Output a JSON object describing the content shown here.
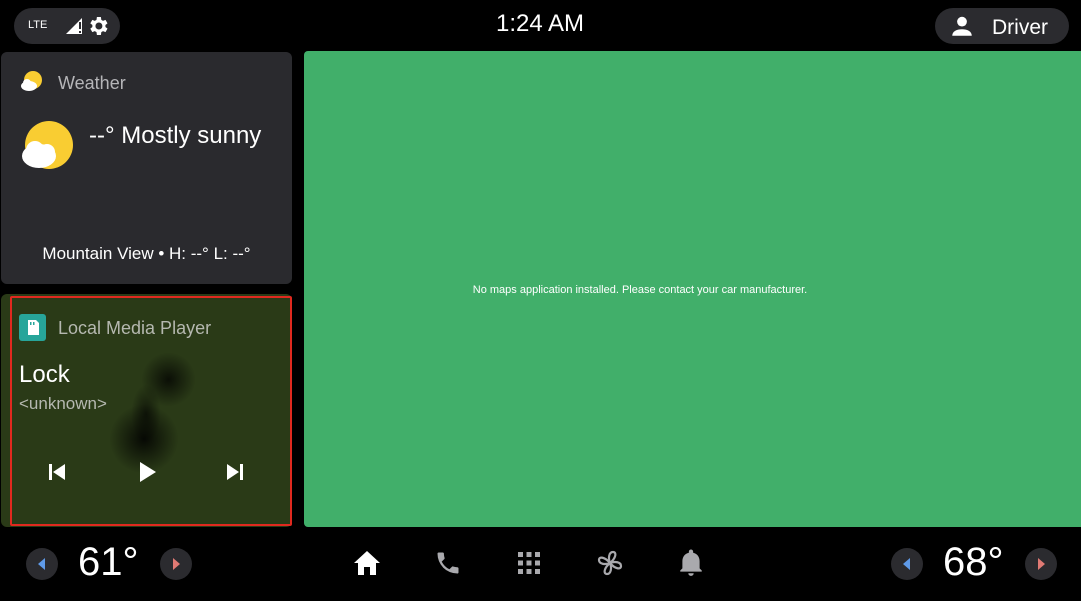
{
  "status_bar": {
    "network_label": "LTE",
    "clock": "1:24 AM",
    "user_label": "Driver"
  },
  "weather": {
    "title": "Weather",
    "condition": "--° Mostly sunny",
    "location": "Mountain View • H: --° L: --°"
  },
  "media": {
    "app_title": "Local Media Player",
    "track": "Lock",
    "artist": "<unknown>"
  },
  "map": {
    "message": "No maps application installed. Please contact your car manufacturer."
  },
  "climate": {
    "left_temp": "61°",
    "right_temp": "68°"
  },
  "colors": {
    "map_bg": "#41af6a",
    "card_bg": "#2a2a2e",
    "media_bg": "#2a3a17",
    "selection": "#e0291f",
    "arrow_blue": "#5f9ae8",
    "arrow_red": "#e07a74"
  }
}
